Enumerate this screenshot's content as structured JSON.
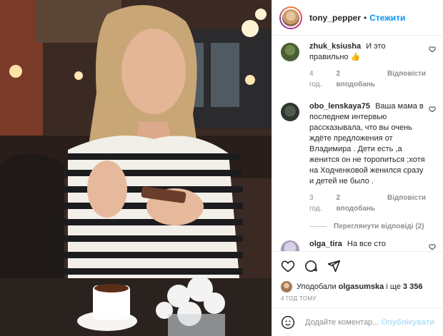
{
  "header": {
    "username": "tony_pepper",
    "separator": "•",
    "follow_label": "Стежити"
  },
  "comments": [
    {
      "username": "zhuk_ksiusha",
      "text": "И это правильно 👍",
      "age": "4 год.",
      "likes": "2 вподобань",
      "reply_label": "Відповісти"
    },
    {
      "username": "obo_lenskaya75",
      "text": "Ваша мама в последнем интервью рассказывала, что вы очень ждёте предложения от Владимира . Дети есть ,а женится он не торопиться ;хотя на Ходченковой женился сразу и детей не было .",
      "age": "3 год.",
      "likes": "2 вподобань",
      "reply_label": "Відповісти",
      "view_replies": "Переглянути відповіді (2)"
    },
    {
      "username": "olga_tira",
      "text": "На все сто процентов вы правы. Я считаю, что известная личность тоже имеет"
    }
  ],
  "likes_line": {
    "prefix": "Уподобали",
    "user": "olgasumska",
    "middle": "і ще",
    "count": "3 356"
  },
  "post_age": "4 ГОД ТОМУ",
  "comment_box": {
    "placeholder": "Додайте коментар...",
    "publish_label": "Опублікувати"
  },
  "icons": {
    "like": "heart-icon",
    "comment": "comment-icon",
    "share": "paper-plane-icon",
    "emoji": "smiley-icon"
  },
  "colors": {
    "link_blue": "#0095f6",
    "muted": "#8e8e8e",
    "publish_disabled": "#b2dffc"
  }
}
